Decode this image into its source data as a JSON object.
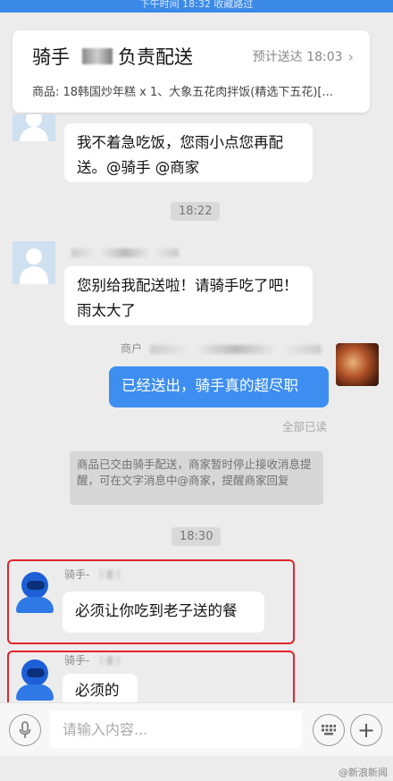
{
  "status_bar": {
    "text": "下午时间 18:32 收藏路过"
  },
  "order_card": {
    "rider_prefix": "骑手",
    "rider_suffix": "负责配送",
    "eta_label": "预计送达 18:03",
    "goods_text": "商品: 18韩国炒年糕 x 1、大象五花肉拌饭(精选下五花)[..."
  },
  "messages": {
    "customer_msg1": "我不着急吃饭，您雨小点您再配送。@骑手 @商家",
    "time1": "18:22",
    "customer_msg2": "您别给我配送啦！请骑手吃了吧！雨太大了",
    "merchant_label": "商户",
    "merchant_msg": "已经送出，骑手真的超尽职",
    "read_status": "全部已读",
    "system_notice": "商品已交由骑手配送，商家暂时停止接收消息提醒，可在文字消息中@商家，提醒商家回复",
    "time2": "18:30",
    "rider_label1": "骑手-",
    "rider_msg1": "必须让你吃到老子送的餐",
    "rider_label2": "骑手-",
    "rider_msg2": "必须的"
  },
  "input_bar": {
    "placeholder": "请输入内容...",
    "voice_icon": "microphone-icon",
    "keyboard_icon": "keyboard-icon",
    "plus_icon": "plus-icon"
  },
  "watermark": "@新浪新闻",
  "colors": {
    "accent_blue": "#3d8ef0",
    "highlight_red": "#e0252b",
    "background": "#ececec"
  }
}
